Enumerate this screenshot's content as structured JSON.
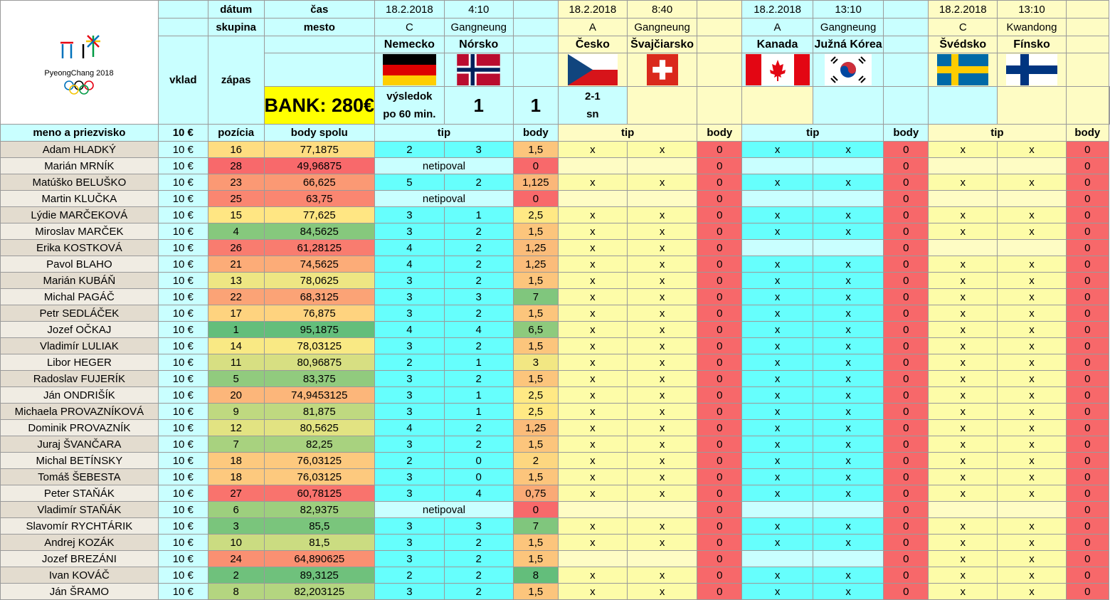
{
  "logo": {
    "text": "PyeongChang 2018",
    "mark_text": "ΠΠ"
  },
  "bank_label": "BANK: 280€",
  "headers": {
    "datum": "dátum",
    "cas": "čas",
    "skupina": "skupina",
    "mesto": "mesto",
    "vklad": "vklad",
    "zapas": "zápas",
    "vysledok_line1": "výsledok",
    "vysledok_line2": "po 60 min.",
    "meno": "meno a priezvisko",
    "stake": "10 €",
    "pozicia": "pozícia",
    "body_spolu": "body spolu",
    "tip": "tip",
    "body": "body"
  },
  "matches": [
    {
      "date": "18.2.2018",
      "time": "4:10",
      "group": "C",
      "city": "Gangneung",
      "home": "Nemecko",
      "away": "Nórsko",
      "home_flag": "germany-flag",
      "away_flag": "norway-flag",
      "score_home": "1",
      "score_away": "1",
      "note_line1": "2-1",
      "note_line2": "sn"
    },
    {
      "date": "18.2.2018",
      "time": "8:40",
      "group": "A",
      "city": "Gangneung",
      "home": "Česko",
      "away": "Švajčiarsko",
      "home_flag": "czech-flag",
      "away_flag": "swiss-flag",
      "score_home": "",
      "score_away": "",
      "note_line1": "",
      "note_line2": ""
    },
    {
      "date": "18.2.2018",
      "time": "13:10",
      "group": "A",
      "city": "Gangneung",
      "home": "Kanada",
      "away": "Južná Kórea",
      "home_flag": "canada-flag",
      "away_flag": "korea-flag",
      "score_home": "",
      "score_away": "",
      "note_line1": "",
      "note_line2": ""
    },
    {
      "date": "18.2.2018",
      "time": "13:10",
      "group": "C",
      "city": "Kwandong",
      "home": "Švédsko",
      "away": "Fínsko",
      "home_flag": "sweden-flag",
      "away_flag": "finland-flag",
      "score_home": "",
      "score_away": "",
      "note_line1": "",
      "note_line2": ""
    }
  ],
  "colors": {
    "red": "#f7686a",
    "cyan": "#66fffd",
    "yellow": "#ffff00"
  },
  "players": [
    {
      "name": "Adam HLADKÝ",
      "stake": "10 €",
      "pos": "16",
      "total": "77,1875",
      "m1": [
        "2",
        "3",
        "1,5"
      ],
      "m2": [
        "x",
        "x",
        "0"
      ],
      "m3": [
        "x",
        "x",
        "0"
      ],
      "m4": [
        "x",
        "x",
        "0"
      ]
    },
    {
      "name": "Marián MRNÍK",
      "stake": "10 €",
      "pos": "28",
      "total": "49,96875",
      "m1": [
        "netipoval",
        "",
        "0"
      ],
      "m2": [
        "",
        "",
        "0"
      ],
      "m3": [
        "",
        "",
        "0"
      ],
      "m4": [
        "",
        "",
        "0"
      ]
    },
    {
      "name": "Matúško BELUŠKO",
      "stake": "10 €",
      "pos": "23",
      "total": "66,625",
      "m1": [
        "5",
        "2",
        "1,125"
      ],
      "m2": [
        "x",
        "x",
        "0"
      ],
      "m3": [
        "x",
        "x",
        "0"
      ],
      "m4": [
        "x",
        "x",
        "0"
      ]
    },
    {
      "name": "Martin KLUČKA",
      "stake": "10 €",
      "pos": "25",
      "total": "63,75",
      "m1": [
        "netipoval",
        "",
        "0"
      ],
      "m2": [
        "",
        "",
        "0"
      ],
      "m3": [
        "",
        "",
        "0"
      ],
      "m4": [
        "",
        "",
        "0"
      ]
    },
    {
      "name": "Lýdie MARČEKOVÁ",
      "stake": "10 €",
      "pos": "15",
      "total": "77,625",
      "m1": [
        "3",
        "1",
        "2,5"
      ],
      "m2": [
        "x",
        "x",
        "0"
      ],
      "m3": [
        "x",
        "x",
        "0"
      ],
      "m4": [
        "x",
        "x",
        "0"
      ]
    },
    {
      "name": "Miroslav MARČEK",
      "stake": "10 €",
      "pos": "4",
      "total": "84,5625",
      "m1": [
        "3",
        "2",
        "1,5"
      ],
      "m2": [
        "x",
        "x",
        "0"
      ],
      "m3": [
        "x",
        "x",
        "0"
      ],
      "m4": [
        "x",
        "x",
        "0"
      ]
    },
    {
      "name": "Erika KOSTKOVÁ",
      "stake": "10 €",
      "pos": "26",
      "total": "61,28125",
      "m1": [
        "4",
        "2",
        "1,25"
      ],
      "m2": [
        "x",
        "x",
        "0"
      ],
      "m3": [
        "",
        "",
        "0"
      ],
      "m4": [
        "",
        "",
        "0"
      ]
    },
    {
      "name": "Pavol BLAHO",
      "stake": "10 €",
      "pos": "21",
      "total": "74,5625",
      "m1": [
        "4",
        "2",
        "1,25"
      ],
      "m2": [
        "x",
        "x",
        "0"
      ],
      "m3": [
        "x",
        "x",
        "0"
      ],
      "m4": [
        "x",
        "x",
        "0"
      ]
    },
    {
      "name": "Marián KUBÁŇ",
      "stake": "10 €",
      "pos": "13",
      "total": "78,0625",
      "m1": [
        "3",
        "2",
        "1,5"
      ],
      "m2": [
        "x",
        "x",
        "0"
      ],
      "m3": [
        "x",
        "x",
        "0"
      ],
      "m4": [
        "x",
        "x",
        "0"
      ]
    },
    {
      "name": "Michal PAGÁČ",
      "stake": "10 €",
      "pos": "22",
      "total": "68,3125",
      "m1": [
        "3",
        "3",
        "7"
      ],
      "m2": [
        "x",
        "x",
        "0"
      ],
      "m3": [
        "x",
        "x",
        "0"
      ],
      "m4": [
        "x",
        "x",
        "0"
      ]
    },
    {
      "name": "Petr SEDLÁČEK",
      "stake": "10 €",
      "pos": "17",
      "total": "76,875",
      "m1": [
        "3",
        "2",
        "1,5"
      ],
      "m2": [
        "x",
        "x",
        "0"
      ],
      "m3": [
        "x",
        "x",
        "0"
      ],
      "m4": [
        "x",
        "x",
        "0"
      ]
    },
    {
      "name": "Jozef OČKAJ",
      "stake": "10 €",
      "pos": "1",
      "total": "95,1875",
      "m1": [
        "4",
        "4",
        "6,5"
      ],
      "m2": [
        "x",
        "x",
        "0"
      ],
      "m3": [
        "x",
        "x",
        "0"
      ],
      "m4": [
        "x",
        "x",
        "0"
      ]
    },
    {
      "name": "Vladimír LULIAK",
      "stake": "10 €",
      "pos": "14",
      "total": "78,03125",
      "m1": [
        "3",
        "2",
        "1,5"
      ],
      "m2": [
        "x",
        "x",
        "0"
      ],
      "m3": [
        "x",
        "x",
        "0"
      ],
      "m4": [
        "x",
        "x",
        "0"
      ]
    },
    {
      "name": "Libor HEGER",
      "stake": "10 €",
      "pos": "11",
      "total": "80,96875",
      "m1": [
        "2",
        "1",
        "3"
      ],
      "m2": [
        "x",
        "x",
        "0"
      ],
      "m3": [
        "x",
        "x",
        "0"
      ],
      "m4": [
        "x",
        "x",
        "0"
      ]
    },
    {
      "name": "Radoslav FUJERÍK",
      "stake": "10 €",
      "pos": "5",
      "total": "83,375",
      "m1": [
        "3",
        "2",
        "1,5"
      ],
      "m2": [
        "x",
        "x",
        "0"
      ],
      "m3": [
        "x",
        "x",
        "0"
      ],
      "m4": [
        "x",
        "x",
        "0"
      ]
    },
    {
      "name": "Ján ONDRIŠÍK",
      "stake": "10 €",
      "pos": "20",
      "total": "74,9453125",
      "m1": [
        "3",
        "1",
        "2,5"
      ],
      "m2": [
        "x",
        "x",
        "0"
      ],
      "m3": [
        "x",
        "x",
        "0"
      ],
      "m4": [
        "x",
        "x",
        "0"
      ]
    },
    {
      "name": "Michaela PROVAZNÍKOVÁ",
      "stake": "10 €",
      "pos": "9",
      "total": "81,875",
      "m1": [
        "3",
        "1",
        "2,5"
      ],
      "m2": [
        "x",
        "x",
        "0"
      ],
      "m3": [
        "x",
        "x",
        "0"
      ],
      "m4": [
        "x",
        "x",
        "0"
      ]
    },
    {
      "name": "Dominik PROVAZNÍK",
      "stake": "10 €",
      "pos": "12",
      "total": "80,5625",
      "m1": [
        "4",
        "2",
        "1,25"
      ],
      "m2": [
        "x",
        "x",
        "0"
      ],
      "m3": [
        "x",
        "x",
        "0"
      ],
      "m4": [
        "x",
        "x",
        "0"
      ]
    },
    {
      "name": "Juraj ŠVANČARA",
      "stake": "10 €",
      "pos": "7",
      "total": "82,25",
      "m1": [
        "3",
        "2",
        "1,5"
      ],
      "m2": [
        "x",
        "x",
        "0"
      ],
      "m3": [
        "x",
        "x",
        "0"
      ],
      "m4": [
        "x",
        "x",
        "0"
      ]
    },
    {
      "name": "Michal BETÍNSKY",
      "stake": "10 €",
      "pos": "18",
      "total": "76,03125",
      "m1": [
        "2",
        "0",
        "2"
      ],
      "m2": [
        "x",
        "x",
        "0"
      ],
      "m3": [
        "x",
        "x",
        "0"
      ],
      "m4": [
        "x",
        "x",
        "0"
      ]
    },
    {
      "name": "Tomáš ŠEBESTA",
      "stake": "10 €",
      "pos": "18",
      "total": "76,03125",
      "m1": [
        "3",
        "0",
        "1,5"
      ],
      "m2": [
        "x",
        "x",
        "0"
      ],
      "m3": [
        "x",
        "x",
        "0"
      ],
      "m4": [
        "x",
        "x",
        "0"
      ]
    },
    {
      "name": "Peter STAŇÁK",
      "stake": "10 €",
      "pos": "27",
      "total": "60,78125",
      "m1": [
        "3",
        "4",
        "0,75"
      ],
      "m2": [
        "x",
        "x",
        "0"
      ],
      "m3": [
        "x",
        "x",
        "0"
      ],
      "m4": [
        "x",
        "x",
        "0"
      ]
    },
    {
      "name": "Vladimír STAŇÁK",
      "stake": "10 €",
      "pos": "6",
      "total": "82,9375",
      "m1": [
        "netipoval",
        "",
        "0"
      ],
      "m2": [
        "",
        "",
        "0"
      ],
      "m3": [
        "",
        "",
        "0"
      ],
      "m4": [
        "",
        "",
        "0"
      ]
    },
    {
      "name": "Slavomír RYCHTÁRIK",
      "stake": "10 €",
      "pos": "3",
      "total": "85,5",
      "m1": [
        "3",
        "3",
        "7"
      ],
      "m2": [
        "x",
        "x",
        "0"
      ],
      "m3": [
        "x",
        "x",
        "0"
      ],
      "m4": [
        "x",
        "x",
        "0"
      ]
    },
    {
      "name": "Andrej KOZÁK",
      "stake": "10 €",
      "pos": "10",
      "total": "81,5",
      "m1": [
        "3",
        "2",
        "1,5"
      ],
      "m2": [
        "x",
        "x",
        "0"
      ],
      "m3": [
        "x",
        "x",
        "0"
      ],
      "m4": [
        "x",
        "x",
        "0"
      ]
    },
    {
      "name": "Jozef BREZÁNI",
      "stake": "10 €",
      "pos": "24",
      "total": "64,890625",
      "m1": [
        "3",
        "2",
        "1,5"
      ],
      "m2": [
        "",
        "",
        "0"
      ],
      "m3": [
        "",
        "",
        "0"
      ],
      "m4": [
        "x",
        "x",
        "0"
      ]
    },
    {
      "name": "Ivan KOVÁČ",
      "stake": "10 €",
      "pos": "2",
      "total": "89,3125",
      "m1": [
        "2",
        "2",
        "8"
      ],
      "m2": [
        "x",
        "x",
        "0"
      ],
      "m3": [
        "x",
        "x",
        "0"
      ],
      "m4": [
        "x",
        "x",
        "0"
      ]
    },
    {
      "name": "Ján ŠRAMO",
      "stake": "10 €",
      "pos": "8",
      "total": "82,203125",
      "m1": [
        "3",
        "2",
        "1,5"
      ],
      "m2": [
        "x",
        "x",
        "0"
      ],
      "m3": [
        "x",
        "x",
        "0"
      ],
      "m4": [
        "x",
        "x",
        "0"
      ]
    }
  ]
}
